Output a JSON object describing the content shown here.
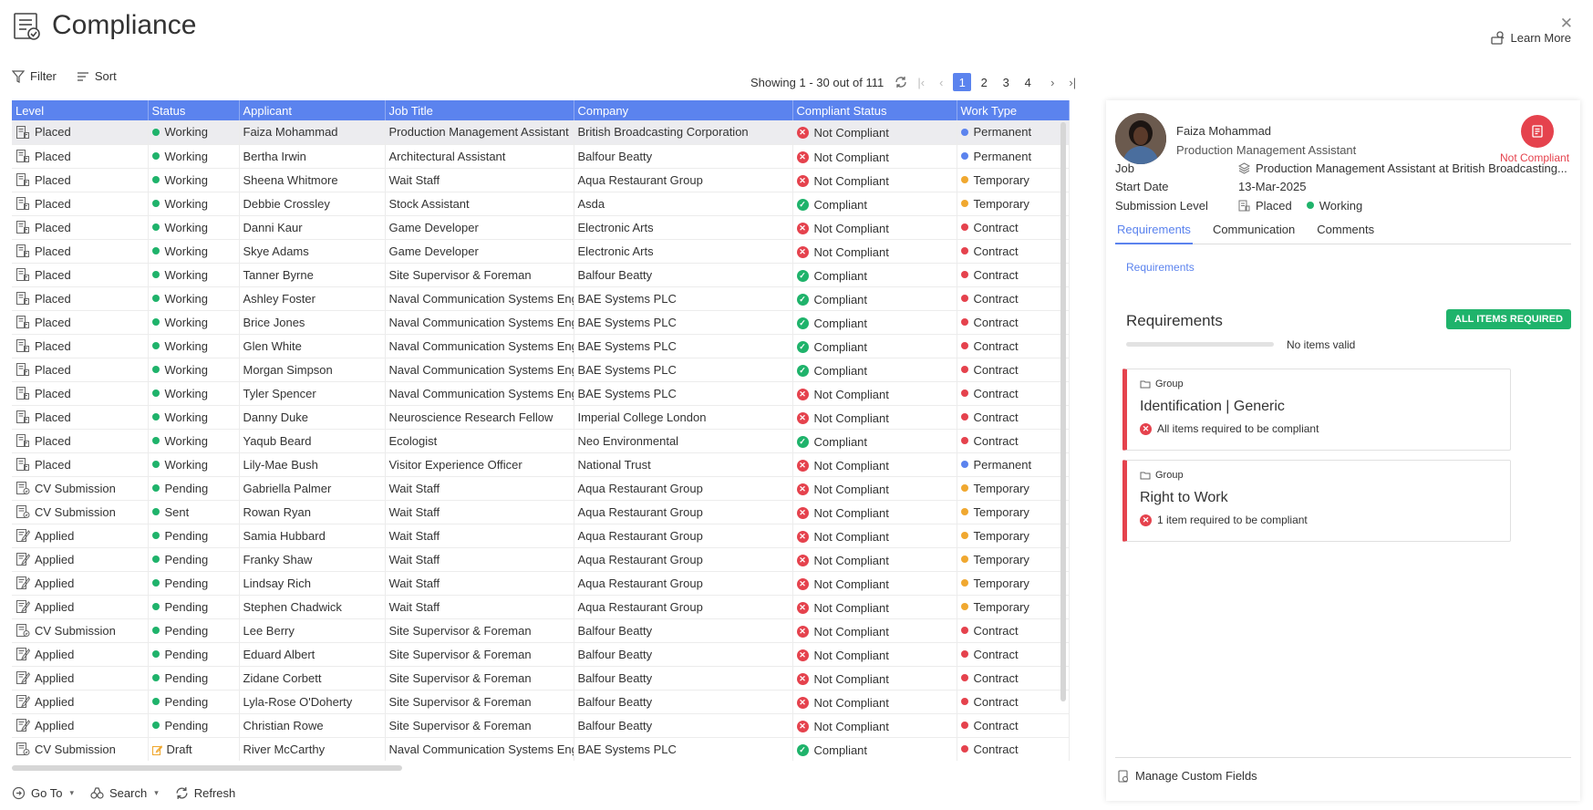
{
  "header": {
    "title": "Compliance",
    "learn_more": "Learn More",
    "close": "✕"
  },
  "toolbar": {
    "filter": "Filter",
    "sort": "Sort"
  },
  "pager": {
    "showing": "Showing 1 - 30 out of 111",
    "pages": [
      "1",
      "2",
      "3",
      "4"
    ],
    "active_page": "1"
  },
  "table": {
    "columns": [
      "Level",
      "Status",
      "Applicant",
      "Job Title",
      "Company",
      "Compliant Status",
      "Work Type"
    ],
    "rows": [
      {
        "level": "Placed",
        "status": "Working",
        "applicant": "Faiza Mohammad",
        "job": "Production Management Assistant",
        "company": "British Broadcasting Corporation",
        "compliant": "Not Compliant",
        "work": "Permanent"
      },
      {
        "level": "Placed",
        "status": "Working",
        "applicant": "Bertha Irwin",
        "job": "Architectural Assistant",
        "company": "Balfour Beatty",
        "compliant": "Not Compliant",
        "work": "Permanent"
      },
      {
        "level": "Placed",
        "status": "Working",
        "applicant": "Sheena Whitmore",
        "job": "Wait Staff",
        "company": "Aqua Restaurant Group",
        "compliant": "Not Compliant",
        "work": "Temporary"
      },
      {
        "level": "Placed",
        "status": "Working",
        "applicant": "Debbie Crossley",
        "job": "Stock Assistant",
        "company": "Asda",
        "compliant": "Compliant",
        "work": "Temporary"
      },
      {
        "level": "Placed",
        "status": "Working",
        "applicant": "Danni Kaur",
        "job": "Game Developer",
        "company": "Electronic Arts",
        "compliant": "Not Compliant",
        "work": "Contract"
      },
      {
        "level": "Placed",
        "status": "Working",
        "applicant": "Skye Adams",
        "job": "Game Developer",
        "company": "Electronic Arts",
        "compliant": "Not Compliant",
        "work": "Contract"
      },
      {
        "level": "Placed",
        "status": "Working",
        "applicant": "Tanner Byrne",
        "job": "Site Supervisor & Foreman",
        "company": "Balfour Beatty",
        "compliant": "Compliant",
        "work": "Contract"
      },
      {
        "level": "Placed",
        "status": "Working",
        "applicant": "Ashley Foster",
        "job": "Naval Communication Systems Eng",
        "company": "BAE Systems PLC",
        "compliant": "Compliant",
        "work": "Contract"
      },
      {
        "level": "Placed",
        "status": "Working",
        "applicant": "Brice Jones",
        "job": "Naval Communication Systems Eng",
        "company": "BAE Systems PLC",
        "compliant": "Compliant",
        "work": "Contract"
      },
      {
        "level": "Placed",
        "status": "Working",
        "applicant": "Glen White",
        "job": "Naval Communication Systems Eng",
        "company": "BAE Systems PLC",
        "compliant": "Compliant",
        "work": "Contract"
      },
      {
        "level": "Placed",
        "status": "Working",
        "applicant": "Morgan Simpson",
        "job": "Naval Communication Systems Eng",
        "company": "BAE Systems PLC",
        "compliant": "Compliant",
        "work": "Contract"
      },
      {
        "level": "Placed",
        "status": "Working",
        "applicant": "Tyler Spencer",
        "job": "Naval Communication Systems Eng",
        "company": "BAE Systems PLC",
        "compliant": "Not Compliant",
        "work": "Contract"
      },
      {
        "level": "Placed",
        "status": "Working",
        "applicant": "Danny Duke",
        "job": "Neuroscience Research Fellow",
        "company": "Imperial College London",
        "compliant": "Not Compliant",
        "work": "Contract"
      },
      {
        "level": "Placed",
        "status": "Working",
        "applicant": "Yaqub Beard",
        "job": "Ecologist",
        "company": "Neo Environmental",
        "compliant": "Compliant",
        "work": "Contract"
      },
      {
        "level": "Placed",
        "status": "Working",
        "applicant": "Lily-Mae Bush",
        "job": "Visitor Experience Officer",
        "company": "National Trust",
        "compliant": "Not Compliant",
        "work": "Permanent"
      },
      {
        "level": "CV Submission",
        "status": "Pending",
        "applicant": "Gabriella Palmer",
        "job": "Wait Staff",
        "company": "Aqua Restaurant Group",
        "compliant": "Not Compliant",
        "work": "Temporary"
      },
      {
        "level": "CV Submission",
        "status": "Sent",
        "applicant": "Rowan Ryan",
        "job": "Wait Staff",
        "company": "Aqua Restaurant Group",
        "compliant": "Not Compliant",
        "work": "Temporary"
      },
      {
        "level": "Applied",
        "status": "Pending",
        "applicant": "Samia Hubbard",
        "job": "Wait Staff",
        "company": "Aqua Restaurant Group",
        "compliant": "Not Compliant",
        "work": "Temporary"
      },
      {
        "level": "Applied",
        "status": "Pending",
        "applicant": "Franky Shaw",
        "job": "Wait Staff",
        "company": "Aqua Restaurant Group",
        "compliant": "Not Compliant",
        "work": "Temporary"
      },
      {
        "level": "Applied",
        "status": "Pending",
        "applicant": "Lindsay Rich",
        "job": "Wait Staff",
        "company": "Aqua Restaurant Group",
        "compliant": "Not Compliant",
        "work": "Temporary"
      },
      {
        "level": "Applied",
        "status": "Pending",
        "applicant": "Stephen Chadwick",
        "job": "Wait Staff",
        "company": "Aqua Restaurant Group",
        "compliant": "Not Compliant",
        "work": "Temporary"
      },
      {
        "level": "CV Submission",
        "status": "Pending",
        "applicant": "Lee Berry",
        "job": "Site Supervisor & Foreman",
        "company": "Balfour Beatty",
        "compliant": "Not Compliant",
        "work": "Contract"
      },
      {
        "level": "Applied",
        "status": "Pending",
        "applicant": "Eduard Albert",
        "job": "Site Supervisor & Foreman",
        "company": "Balfour Beatty",
        "compliant": "Not Compliant",
        "work": "Contract"
      },
      {
        "level": "Applied",
        "status": "Pending",
        "applicant": "Zidane Corbett",
        "job": "Site Supervisor & Foreman",
        "company": "Balfour Beatty",
        "compliant": "Not Compliant",
        "work": "Contract"
      },
      {
        "level": "Applied",
        "status": "Pending",
        "applicant": "Lyla-Rose O'Doherty",
        "job": "Site Supervisor & Foreman",
        "company": "Balfour Beatty",
        "compliant": "Not Compliant",
        "work": "Contract"
      },
      {
        "level": "Applied",
        "status": "Pending",
        "applicant": "Christian Rowe",
        "job": "Site Supervisor & Foreman",
        "company": "Balfour Beatty",
        "compliant": "Not Compliant",
        "work": "Contract"
      },
      {
        "level": "CV Submission",
        "status": "Draft",
        "applicant": "River McCarthy",
        "job": "Naval Communication Systems Eng",
        "company": "BAE Systems PLC",
        "compliant": "Compliant",
        "work": "Contract"
      }
    ]
  },
  "colors": {
    "accent": "#5b83ee",
    "working": "#1fb36b",
    "pending": "#1fb36b",
    "sent": "#1fb36b",
    "permanent": "#5b83ee",
    "temporary": "#f0a830",
    "contract": "#e5424d",
    "not_compliant": "#e5424d",
    "compliant": "#1fb36b",
    "draft": "#f0a830"
  },
  "bottombar": {
    "goto": "Go To",
    "search": "Search",
    "refresh": "Refresh"
  },
  "panel": {
    "name": "Faiza Mohammad",
    "role": "Production Management Assistant",
    "status_badge": "Not Compliant",
    "job_label": "Job",
    "job_value": "Production Management Assistant at British Broadcasting...",
    "start_label": "Start Date",
    "start_value": "13-Mar-2025",
    "submission_label": "Submission Level",
    "submission_level": "Placed",
    "submission_status": "Working",
    "tabs": [
      "Requirements",
      "Communication",
      "Comments"
    ],
    "req_link": "Requirements",
    "req_title": "Requirements",
    "all_items": "ALL ITEMS REQUIRED",
    "progress_fraction": 0,
    "progress_text": "No items valid",
    "groups": [
      {
        "label": "Group",
        "name": "Identification | Generic",
        "status": "All items required to be compliant"
      },
      {
        "label": "Group",
        "name": "Right to Work",
        "status": "1 item required to be compliant"
      }
    ],
    "manage": "Manage Custom Fields"
  }
}
